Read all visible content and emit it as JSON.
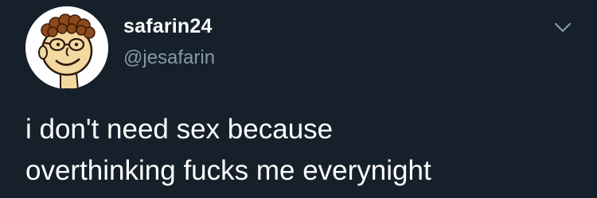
{
  "tweet": {
    "author": {
      "display_name": "safarin24",
      "handle": "@jesafarin",
      "avatar_icon": "cartoon-face-avatar"
    },
    "menu_icon": "chevron-down-icon",
    "text_lines": [
      "i don't need sex because",
      "overthinking fucks me everynight"
    ]
  },
  "colors": {
    "background": "#15202b",
    "text": "#ffffff",
    "secondary_text": "#8899a6"
  }
}
